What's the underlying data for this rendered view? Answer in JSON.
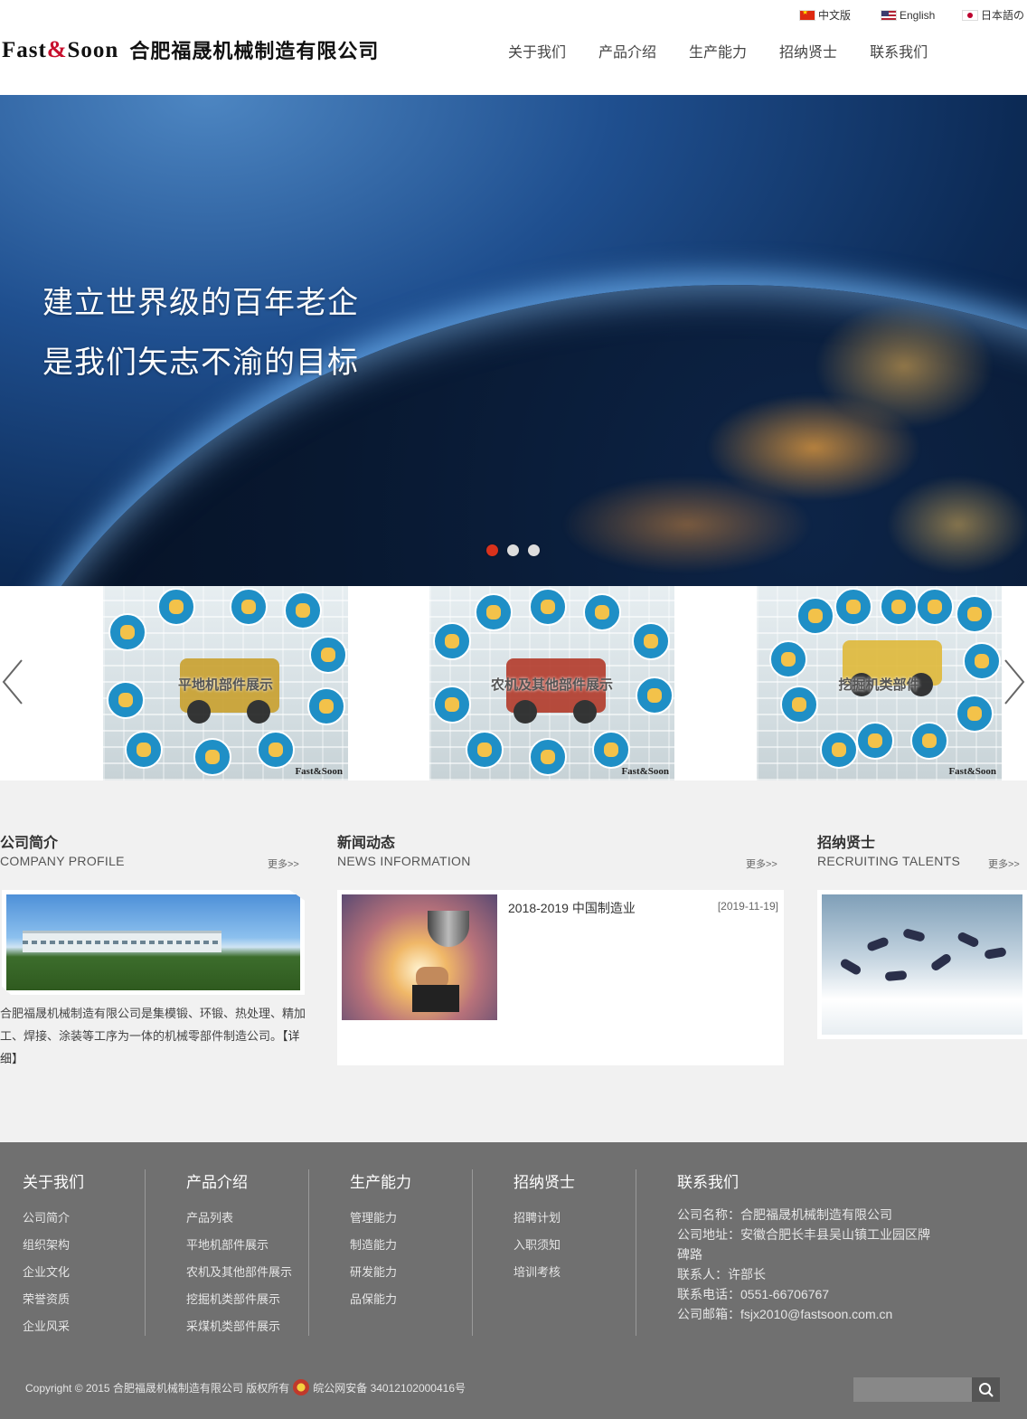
{
  "header": {
    "brand_left": "Fast",
    "brand_amp": "&",
    "brand_right": "Soon",
    "company_name": "合肥福晟机械制造有限公司",
    "languages": [
      {
        "label": "中文版",
        "flag": "cn-flag-icon"
      },
      {
        "label": "English",
        "flag": "us-flag-icon"
      },
      {
        "label": "日本語の",
        "flag": "jp-flag-icon"
      }
    ],
    "nav": [
      "关于我们",
      "产品介绍",
      "生产能力",
      "招纳贤士",
      "联系我们"
    ]
  },
  "hero": {
    "line1": "建立世界级的百年老企",
    "line2": "是我们矢志不渝的目标",
    "slides": 3,
    "active_slide": 1
  },
  "products": {
    "items": [
      {
        "caption": "平地机部件展示",
        "watermark": "Fast&Soon"
      },
      {
        "caption": "农机及其他部件展示",
        "watermark": "Fast&Soon"
      },
      {
        "caption": "挖掘机类部件",
        "watermark": "Fast&Soon"
      }
    ]
  },
  "sections": {
    "profile": {
      "title": "公司简介",
      "subtitle": "COMPANY PROFILE",
      "more": "更多>>",
      "text": "合肥福晟机械制造有限公司是集模锻、环锻、热处理、精加工、焊接、涂装等工序为一体的机械零部件制造公司。",
      "detail": "【详细】"
    },
    "news": {
      "title": "新闻动态",
      "subtitle": "NEWS INFORMATION",
      "more": "更多>>",
      "item_title": "2018-2019 中国制造业",
      "item_date": "[2019-11-19]"
    },
    "talent": {
      "title": "招纳贤士",
      "subtitle": "RECRUITING TALENTS",
      "more": "更多>>"
    }
  },
  "footer": {
    "columns": [
      {
        "head": "关于我们",
        "items": [
          "公司简介",
          "组织架构",
          "企业文化",
          "荣誉资质",
          "企业风采"
        ]
      },
      {
        "head": "产品介绍",
        "items": [
          "产品列表",
          "平地机部件展示",
          "农机及其他部件展示",
          "挖掘机类部件展示",
          "采煤机类部件展示"
        ]
      },
      {
        "head": "生产能力",
        "items": [
          "管理能力",
          "制造能力",
          "研发能力",
          "品保能力"
        ]
      },
      {
        "head": "招纳贤士",
        "items": [
          "招聘计划",
          "入职须知",
          "培训考核"
        ]
      }
    ],
    "contact": {
      "head": "联系我们",
      "lines": [
        "公司名称：合肥福晟机械制造有限公司",
        "公司地址：安徽合肥长丰县吴山镇工业园区牌",
        "碑路",
        "联系人：许部长",
        "联系电话：0551-66706767",
        "公司邮箱：fsjx2010@fastsoon.com.cn"
      ]
    },
    "copyright": "Copyright © 2015 合肥福晟机械制造有限公司 版权所有",
    "icp": "皖公网安备 34012102000416号",
    "search_placeholder": ""
  }
}
